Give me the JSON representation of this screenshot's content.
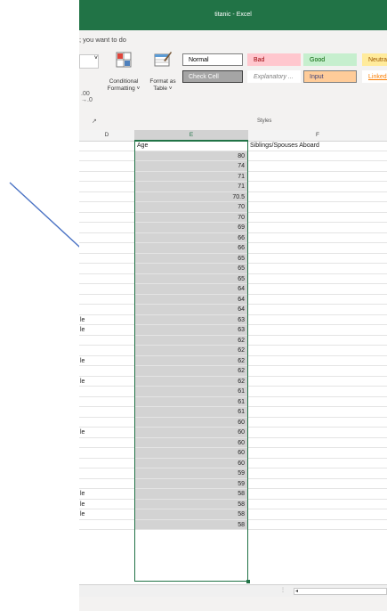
{
  "window": {
    "title": "titanic - Excel"
  },
  "tell_me": "; you want to do",
  "ribbon": {
    "number_format_value": "",
    "decimal_glyph": ".00\n→.0",
    "conditional_formatting": "Conditional\nFormatting ˅",
    "format_as_table": "Format as\nTable ˅",
    "group_launcher": "↗",
    "styles_group_label": "Styles",
    "styles": [
      {
        "label": "Normal",
        "bg": "#ffffff",
        "fg": "#000000",
        "border": "#7f7f7f",
        "italic": false,
        "underline": false
      },
      {
        "label": "Bad",
        "bg": "#ffc7ce",
        "fg": "#9c0006",
        "border": "#ffc7ce",
        "italic": false,
        "underline": false
      },
      {
        "label": "Good",
        "bg": "#c6efce",
        "fg": "#006100",
        "border": "#c6efce",
        "italic": false,
        "underline": false
      },
      {
        "label": "Neutral",
        "bg": "#ffeb9c",
        "fg": "#9c5700",
        "border": "#ffeb9c",
        "italic": false,
        "underline": false
      },
      {
        "label": "Check Cell",
        "bg": "#a5a5a5",
        "fg": "#ffffff",
        "border": "#3f3f3f",
        "italic": false,
        "underline": false
      },
      {
        "label": "Explanatory ...",
        "bg": "#ffffff",
        "fg": "#7f7f7f",
        "border": "#ffffff",
        "italic": true,
        "underline": false
      },
      {
        "label": "Input",
        "bg": "#ffcc99",
        "fg": "#3f3f76",
        "border": "#7f7f7f",
        "italic": false,
        "underline": false
      },
      {
        "label": "Linked Cell",
        "bg": "#ffffff",
        "fg": "#fa7d00",
        "border": "#ffffff",
        "italic": false,
        "underline": true
      }
    ]
  },
  "columns": [
    {
      "letter": "D",
      "selected": false
    },
    {
      "letter": "E",
      "selected": true
    },
    {
      "letter": "F",
      "selected": false
    }
  ],
  "header_row": {
    "d": "",
    "e": "Age",
    "f": "Siblings/Spouses Aboard"
  },
  "rows": [
    {
      "d": "",
      "age": "80"
    },
    {
      "d": "",
      "age": "74"
    },
    {
      "d": "",
      "age": "71"
    },
    {
      "d": "",
      "age": "71"
    },
    {
      "d": "",
      "age": "70.5"
    },
    {
      "d": "",
      "age": "70"
    },
    {
      "d": "",
      "age": "70"
    },
    {
      "d": "",
      "age": "69"
    },
    {
      "d": "",
      "age": "66"
    },
    {
      "d": "",
      "age": "66"
    },
    {
      "d": "",
      "age": "65"
    },
    {
      "d": "",
      "age": "65"
    },
    {
      "d": "",
      "age": "65"
    },
    {
      "d": "",
      "age": "64"
    },
    {
      "d": "",
      "age": "64"
    },
    {
      "d": "",
      "age": "64"
    },
    {
      "d": "le",
      "age": "63"
    },
    {
      "d": "le",
      "age": "63"
    },
    {
      "d": "",
      "age": "62"
    },
    {
      "d": "",
      "age": "62"
    },
    {
      "d": "le",
      "age": "62"
    },
    {
      "d": "",
      "age": "62"
    },
    {
      "d": "le",
      "age": "62"
    },
    {
      "d": "",
      "age": "61"
    },
    {
      "d": "",
      "age": "61"
    },
    {
      "d": "",
      "age": "61"
    },
    {
      "d": "",
      "age": "60"
    },
    {
      "d": "le",
      "age": "60"
    },
    {
      "d": "",
      "age": "60"
    },
    {
      "d": "",
      "age": "60"
    },
    {
      "d": "",
      "age": "60"
    },
    {
      "d": "",
      "age": "59"
    },
    {
      "d": "",
      "age": "59"
    },
    {
      "d": "le",
      "age": "58"
    },
    {
      "d": "le",
      "age": "58"
    },
    {
      "d": "le",
      "age": "58"
    },
    {
      "d": "",
      "age": "58"
    }
  ],
  "colors": {
    "excel_green": "#217346",
    "annotation_arrow": "#4a72c4"
  },
  "icons": {
    "conditional_formatting": "conditional-formatting-icon",
    "format_as_table": "format-as-table-icon",
    "sheet_scroll_left": "◂"
  }
}
